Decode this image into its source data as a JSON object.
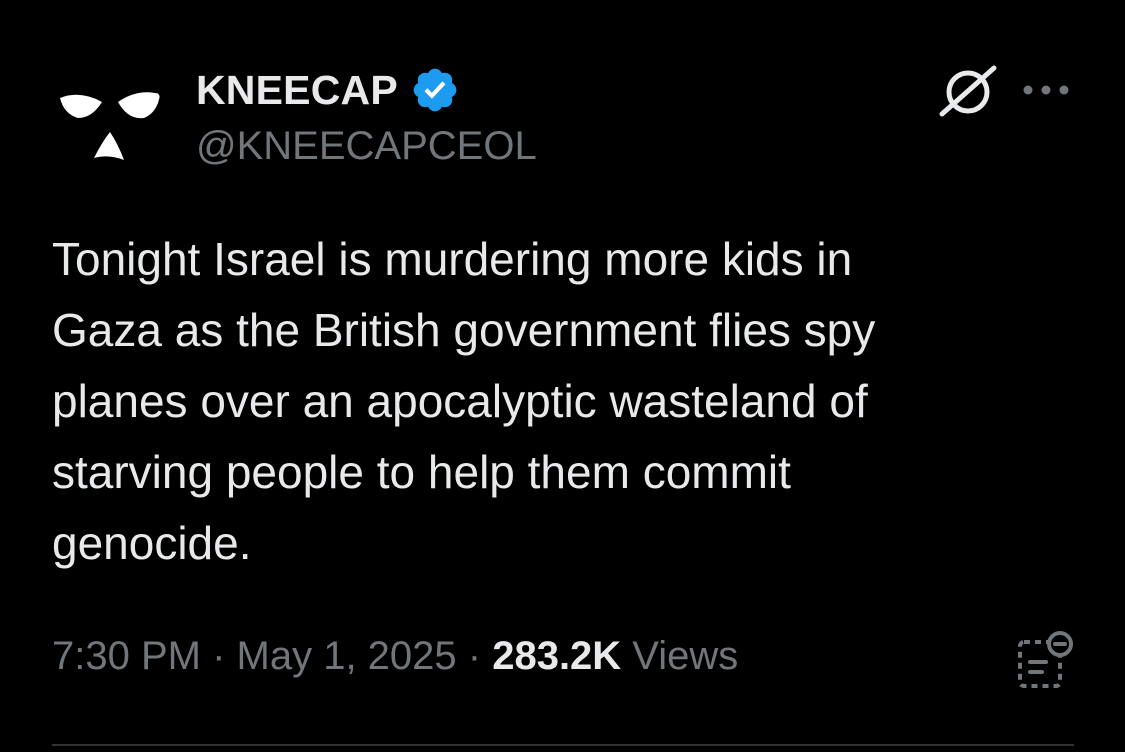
{
  "author": {
    "display_name": "KNEECAP",
    "handle": "@KNEECAPCEOL",
    "verified": true,
    "avatar_icon": "balaclava-face-logo",
    "verified_icon": "verified-badge-icon",
    "verified_color": "#1d9bf0"
  },
  "header_actions": {
    "grok_icon": "grok-icon",
    "more_icon": "more-options-icon"
  },
  "tweet": {
    "text": "Tonight Israel is murdering more kids in\nGaza as the British government flies spy\nplanes over an apocalyptic wasteland of\nstarving people to help them commit\ngenocide."
  },
  "meta": {
    "time": "7:30 PM",
    "separator": " · ",
    "date": "May 1, 2025",
    "views_count": "283.2K",
    "views_label": " Views",
    "notes_icon": "community-notes-icon"
  },
  "colors": {
    "background": "#000000",
    "primary_text": "#e7e9ea",
    "secondary_text": "#71767b",
    "divider": "#2f3336"
  }
}
